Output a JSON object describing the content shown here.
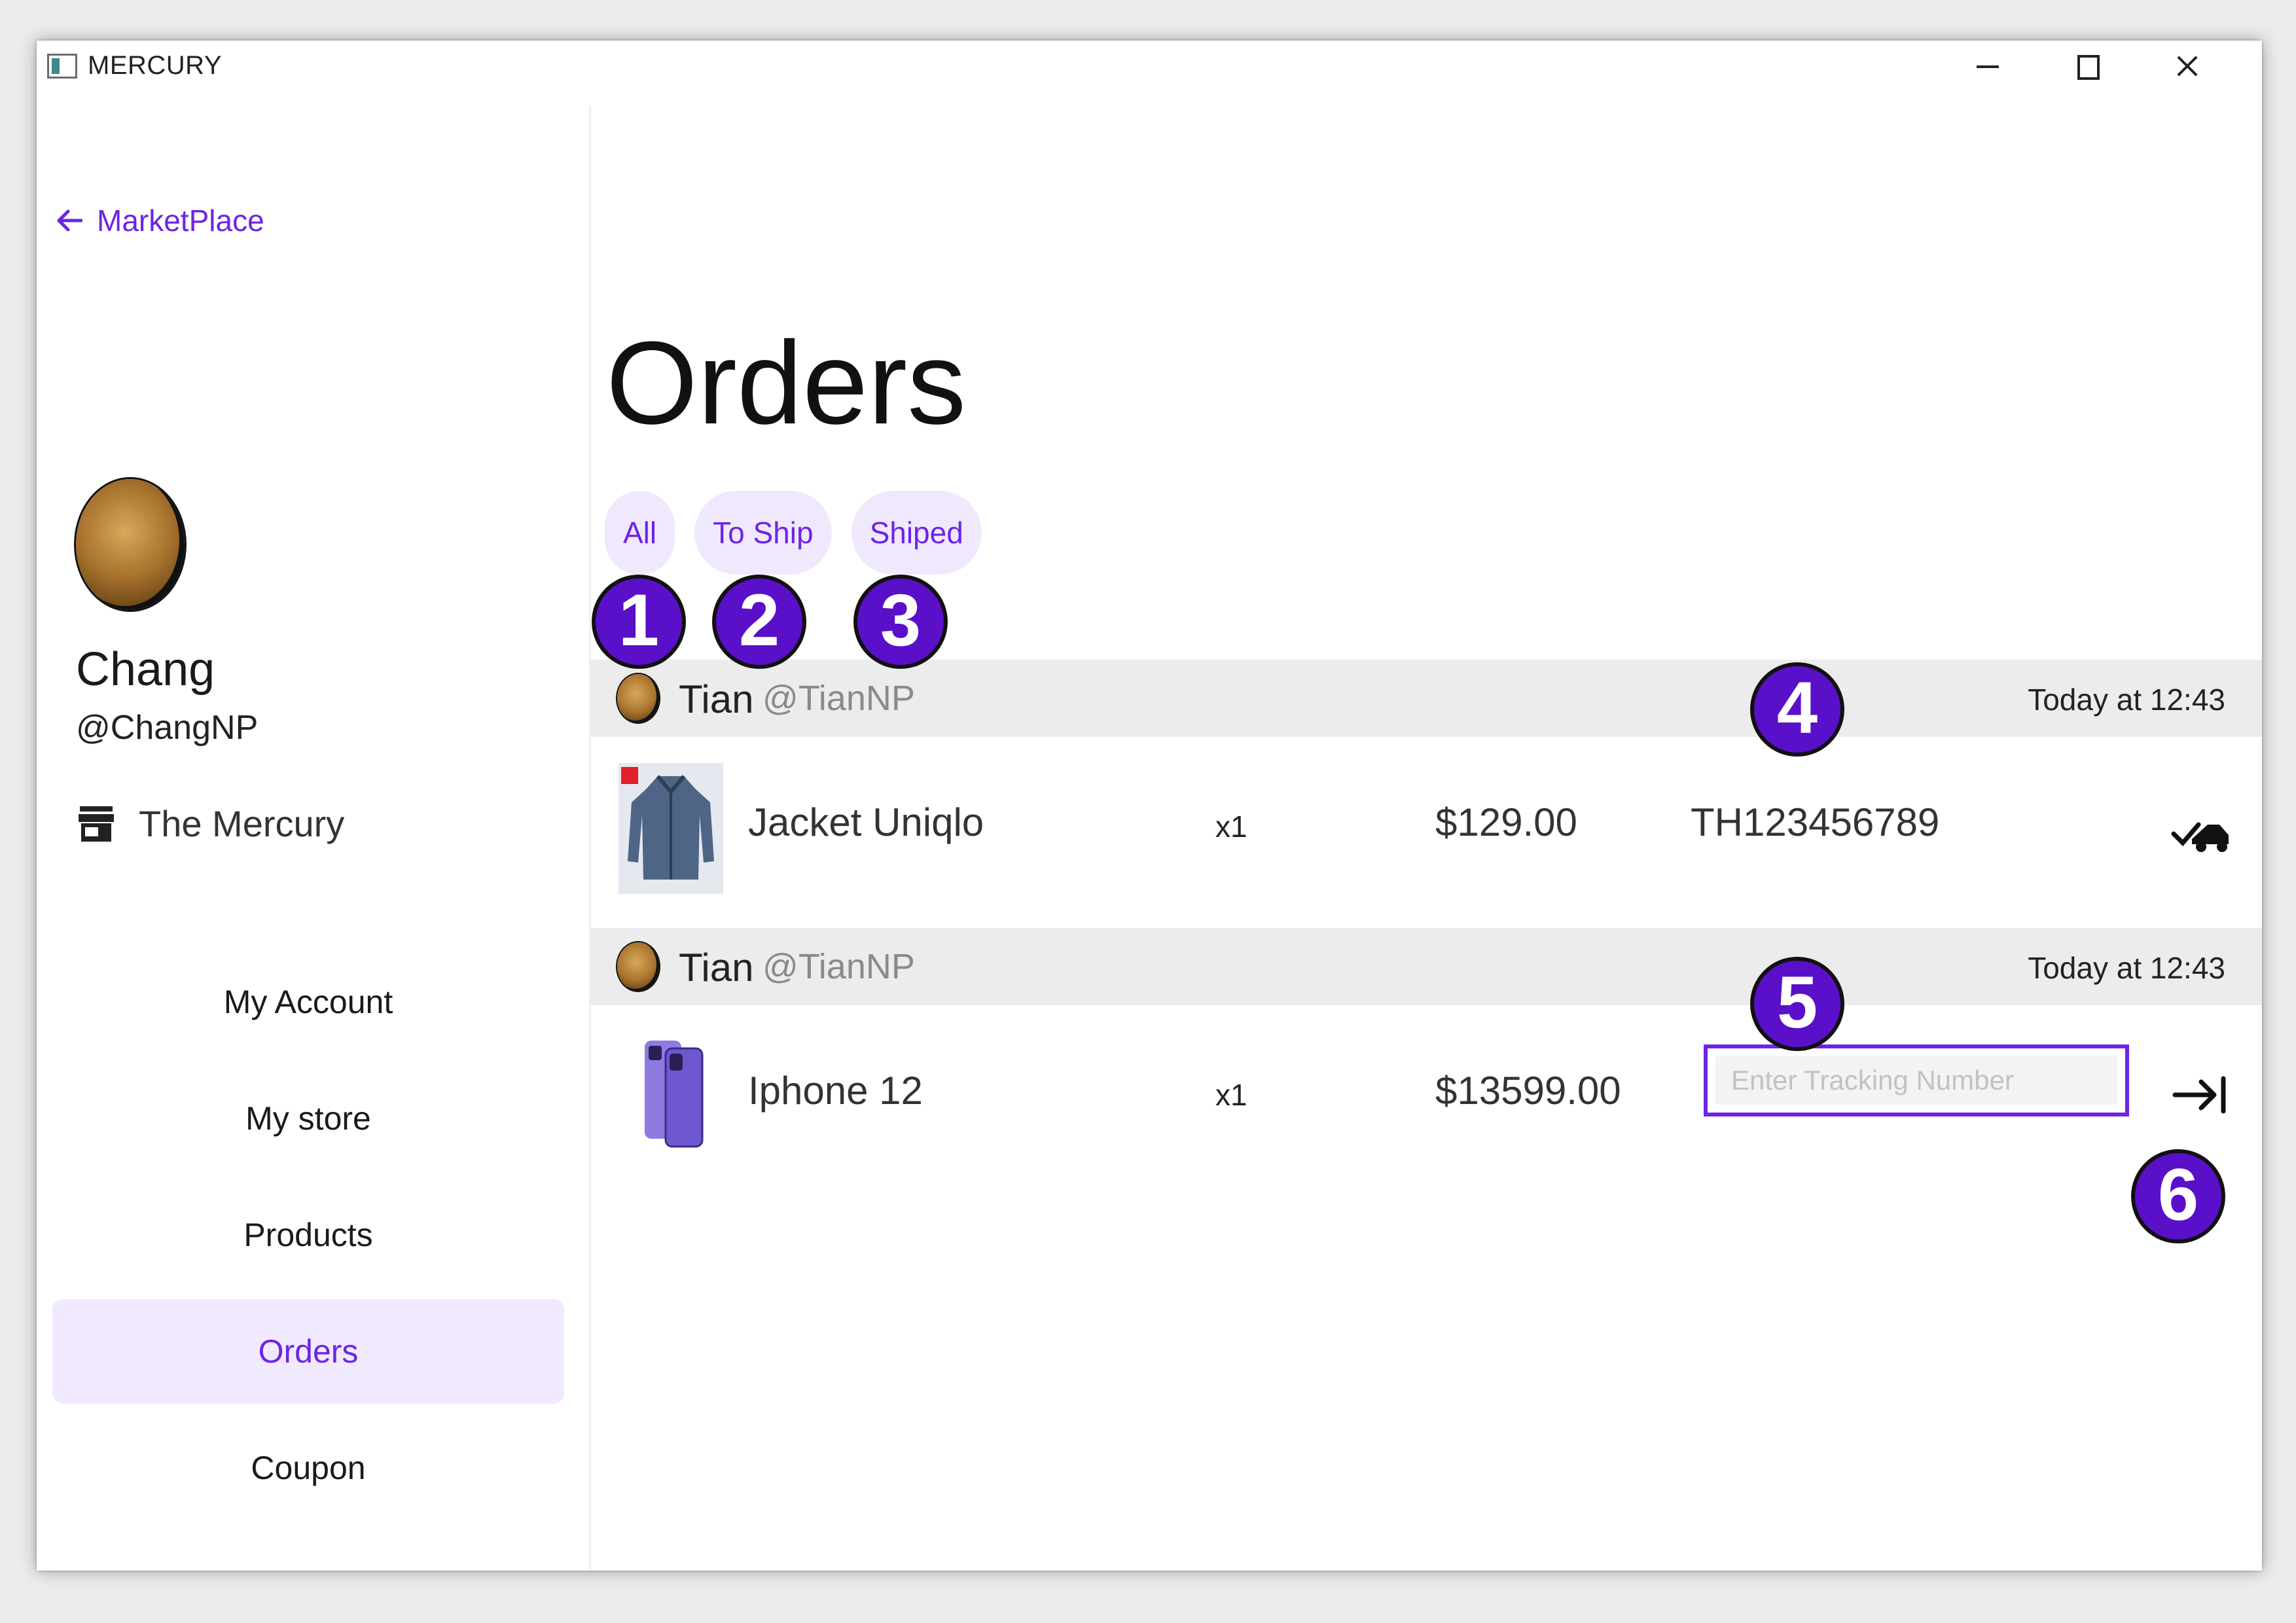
{
  "window": {
    "title": "MERCURY"
  },
  "sidebar": {
    "back_label": "MarketPlace",
    "profile": {
      "name": "Chang",
      "handle": "@ChangNP"
    },
    "store_name": "The Mercury",
    "nav": [
      {
        "label": "My Account",
        "active": false
      },
      {
        "label": "My store",
        "active": false
      },
      {
        "label": "Products",
        "active": false
      },
      {
        "label": "Orders",
        "active": true
      },
      {
        "label": "Coupon",
        "active": false
      }
    ]
  },
  "main": {
    "title": "Orders",
    "tabs": [
      "All",
      "To Ship",
      "Shiped"
    ],
    "orders": [
      {
        "buyer_name": "Tian",
        "buyer_handle": "@TianNP",
        "time": "Today at 12:43",
        "product": "Jacket Uniqlo",
        "qty": "x1",
        "price": "$129.00",
        "tracking": "TH123456789",
        "action_icon": "shipped-truck-check-icon"
      },
      {
        "buyer_name": "Tian",
        "buyer_handle": "@TianNP",
        "time": "Today at 12:43",
        "product": "Iphone 12",
        "qty": "x1",
        "price": "$13599.00",
        "tracking_placeholder": "Enter Tracking Number",
        "tracking_value": "",
        "action_icon": "arrow-right-to-bar-icon"
      }
    ]
  },
  "annotations": [
    "1",
    "2",
    "3",
    "4",
    "5",
    "6"
  ],
  "colors": {
    "accent": "#6d24e6",
    "accent_bg": "#f1eafe",
    "badge": "#5a0fc8",
    "header_bg": "#ececec"
  }
}
